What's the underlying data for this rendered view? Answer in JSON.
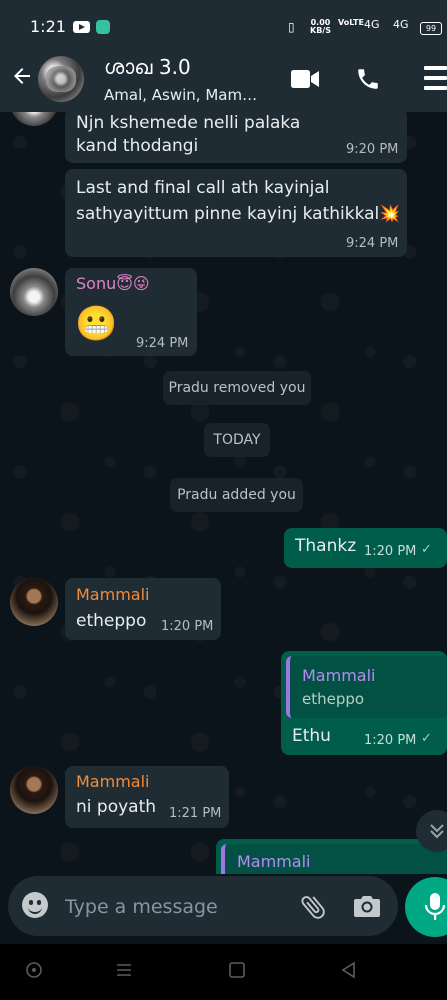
{
  "status_bar": {
    "time": "1:21",
    "net_speed_value": "0.00",
    "net_speed_unit": "KB/S",
    "lte_label": "VoLTE",
    "signal1": "4G",
    "signal2": "4G",
    "battery": "99"
  },
  "header": {
    "title": "ശാഖ 3.0",
    "subtitle": "Amal, Aswin, Mam…"
  },
  "messages": [
    {
      "text": "Njn kshemede nelli palaka kand thodangi",
      "time": "9:20 PM"
    },
    {
      "text": "Last and final call ath kayinjal sathyayittum pinne kayinj kathikkal💥",
      "time": "9:24 PM"
    },
    {
      "sender": "Sonu😇😜",
      "text": "😬",
      "time": "9:24 PM"
    },
    {
      "system": "Pradu removed you"
    },
    {
      "system": "TODAY"
    },
    {
      "system": "Pradu added you"
    },
    {
      "text": "Thankz",
      "time": "1:20 PM"
    },
    {
      "sender": "Mammali",
      "text": "etheppo",
      "time": "1:20 PM"
    },
    {
      "quote_sender": "Mammali",
      "quote_text": "etheppo",
      "text": "Ethu",
      "time": "1:20 PM"
    },
    {
      "sender": "Mammali",
      "text": "ni poyath",
      "time": "1:21 PM"
    },
    {
      "quote_sender": "Mammali"
    }
  ],
  "input": {
    "placeholder": "Type a message"
  },
  "colors": {
    "outgoing_bubble": "#005c4b",
    "incoming_bubble": "#202c33",
    "accent": "#00a884",
    "sonu_name": "#e083c9",
    "mammali_name": "#f08c3c",
    "quote_name": "#b38df5"
  }
}
